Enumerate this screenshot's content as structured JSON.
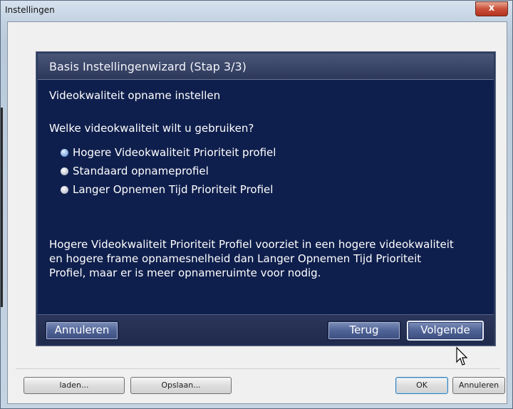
{
  "window": {
    "title": "Instellingen",
    "close_label": "x"
  },
  "wizard": {
    "title": "Basis Instellingenwizard (Stap 3/3)",
    "heading": "Videokwaliteit opname instellen",
    "question": "Welke videokwaliteit wilt u gebruiken?",
    "options": [
      {
        "label": "Hogere Videokwaliteit Prioriteit profiel",
        "selected": true
      },
      {
        "label": "Standaard opnameprofiel",
        "selected": false
      },
      {
        "label": "Langer Opnemen Tijd Prioriteit Profiel",
        "selected": false
      }
    ],
    "description_lines": [
      "Hogere Videokwaliteit Prioriteit Profiel voorziet in een hogere videokwaliteit",
      "en hogere frame opnamesnelheid dan Langer Opnemen Tijd Prioriteit",
      "Profiel, maar er is meer opnameruimte voor nodig."
    ],
    "buttons": {
      "cancel": "Annuleren",
      "back": "Terug",
      "next": "Volgende"
    }
  },
  "footer": {
    "load": "laden...",
    "save": "Opslaan...",
    "ok": "OK",
    "cancel": "Annuleren"
  },
  "colors": {
    "wizard_bg": "#0f1f4d",
    "wizard_header": "#3a4668",
    "button_blue": "#4f6396",
    "close_red": "#c9503a"
  }
}
